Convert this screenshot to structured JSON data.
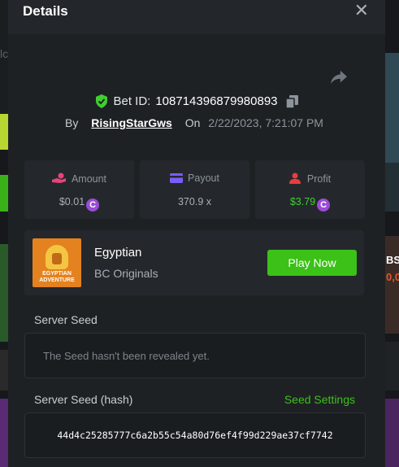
{
  "modal": {
    "title": "Details"
  },
  "bet": {
    "id_label": "Bet ID:",
    "id": "108714396879980893",
    "by_label": "By",
    "user": "RisingStarGws",
    "on_label": "On",
    "date": "2/22/2023, 7:21:07 PM"
  },
  "stats": {
    "amount": {
      "label": "Amount",
      "value": "$0.01"
    },
    "payout": {
      "label": "Payout",
      "value": "370.9 x"
    },
    "profit": {
      "label": "Profit",
      "value": "$3.79"
    }
  },
  "game": {
    "name": "Egyptian",
    "provider": "BC Originals",
    "thumb_text_1": "EGYPTIAN",
    "thumb_text_2": "ADVENTURE",
    "play_label": "Play Now"
  },
  "seeds": {
    "server_seed_label": "Server Seed",
    "server_seed_value": "The Seed hasn't been revealed yet.",
    "hash_label": "Server Seed (hash)",
    "settings_label": "Seed Settings",
    "hash_value": "44d4c25285777c6a2b55c54a80d76ef4f99d229ae37cf7742"
  },
  "background": {
    "left_fragment_1": "lc",
    "right_fragment_1": "BS",
    "right_fragment_2": "0,0"
  },
  "colors": {
    "accent_green": "#3bc117",
    "profit_green": "#3fcf2f",
    "coin_purple": "#9b4bd6",
    "amount_pink": "#e8437a",
    "payout_purple": "#7c5cff",
    "profit_red": "#e53e3e"
  },
  "icons": {
    "close": "close-icon",
    "share": "share-icon",
    "verified": "shield-check-icon",
    "copy": "copy-icon",
    "coin": "coin-icon"
  }
}
